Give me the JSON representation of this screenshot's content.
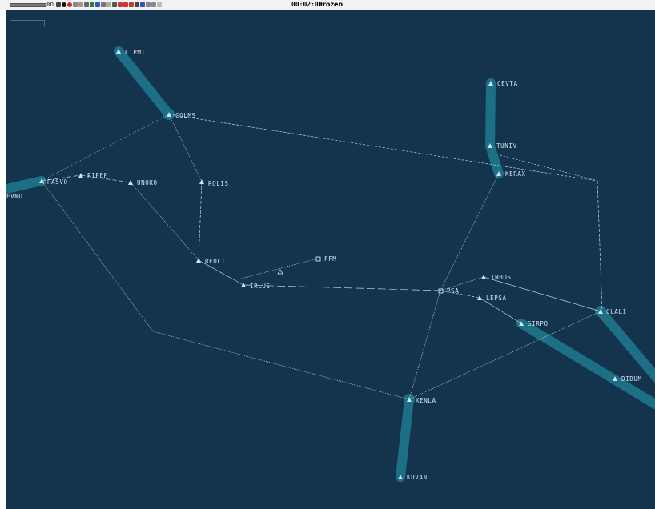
{
  "toolbar": {
    "zoom_value": "80",
    "clock": "00:02:00",
    "status": "Frozen",
    "icons": [
      "zoom-slider",
      "undo-icon",
      "record-icon",
      "stop-icon",
      "route-icon",
      "map-icon",
      "layer-icon",
      "filter-icon",
      "grid-icon",
      "label-icon",
      "measure-icon",
      "settings-icon",
      "play-icon",
      "pause-icon",
      "step-icon",
      "help-icon"
    ]
  },
  "colors": {
    "scope_background": "#14344e",
    "airway": "#1d6f86",
    "route_line": "#b9d3e0",
    "label": "#cfe3ef"
  },
  "waypoints": [
    {
      "id": "LIPMI",
      "label": "LIPMI",
      "symbol": "triangle"
    },
    {
      "id": "COLMS",
      "label": "COLMS",
      "symbol": "triangle"
    },
    {
      "id": "CEVTA",
      "label": "CEVTA",
      "symbol": "triangle"
    },
    {
      "id": "TUNIV",
      "label": "TUNIV",
      "symbol": "triangle"
    },
    {
      "id": "KERAX",
      "label": "KERAX",
      "symbol": "triangle"
    },
    {
      "id": "EVNU",
      "label": "EVNU",
      "symbol": "none"
    },
    {
      "id": "RASVO",
      "label": "RASVO",
      "symbol": "triangle"
    },
    {
      "id": "PIPEP",
      "label": "PIPEP",
      "symbol": "triangle"
    },
    {
      "id": "UNOKO",
      "label": "UNOKO",
      "symbol": "triangle"
    },
    {
      "id": "ROLIS",
      "label": "ROLIS",
      "symbol": "triangle"
    },
    {
      "id": "REOLI",
      "label": "REOLI",
      "symbol": "triangle"
    },
    {
      "id": "FFM",
      "label": "FFM",
      "symbol": "square"
    },
    {
      "id": "IRLUS",
      "label": "IRLUS",
      "symbol": "triangle"
    },
    {
      "id": "PSA",
      "label": "PSA",
      "symbol": "square"
    },
    {
      "id": "INBOS",
      "label": "INBOS",
      "symbol": "triangle"
    },
    {
      "id": "LEPSA",
      "label": "LEPSA",
      "symbol": "triangle"
    },
    {
      "id": "SIRPO",
      "label": "SIRPO",
      "symbol": "triangle"
    },
    {
      "id": "OLALI",
      "label": "OLALI",
      "symbol": "triangle"
    },
    {
      "id": "DIDUM",
      "label": "DIDUM",
      "symbol": "triangle"
    },
    {
      "id": "XENLA",
      "label": "XENLA",
      "symbol": "triangle"
    },
    {
      "id": "KOVAN",
      "label": "KOVAN",
      "symbol": "triangle"
    }
  ]
}
